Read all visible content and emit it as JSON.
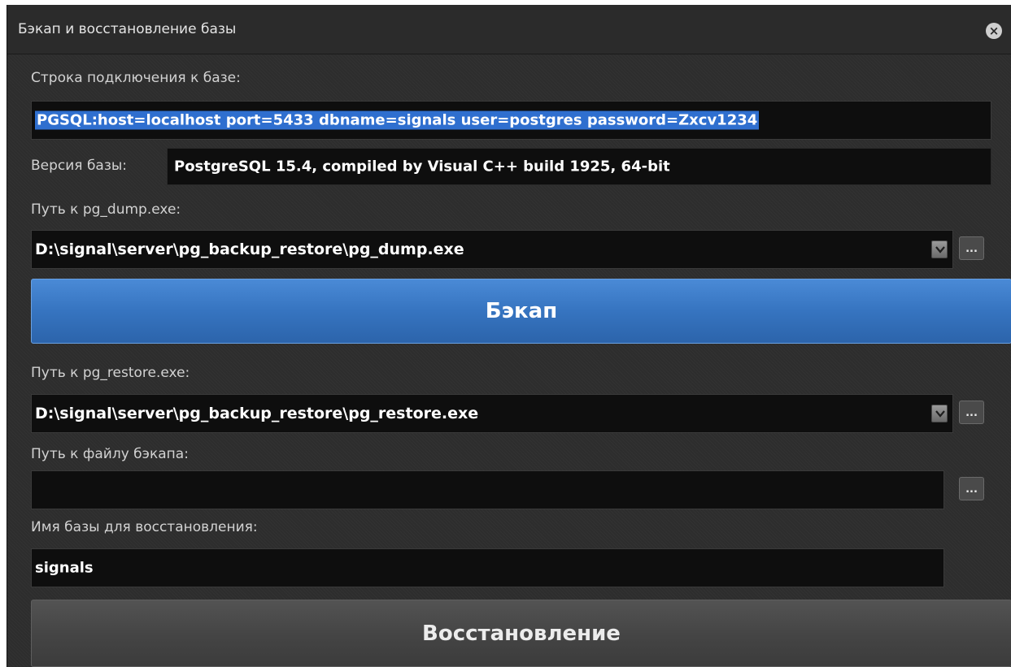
{
  "window": {
    "title": "Бэкап и восстановление базы",
    "close_glyph": "×"
  },
  "connection": {
    "label": "Строка подключения к базе:",
    "value": "PGSQL:host=localhost port=5433 dbname=signals user=postgres password=Zxcv1234"
  },
  "version": {
    "label": "Версия базы:",
    "value": "PostgreSQL 15.4, compiled by Visual C++ build 1925, 64-bit"
  },
  "pg_dump": {
    "label": "Путь к pg_dump.exe:",
    "value": "D:\\signal\\server\\pg_backup_restore\\pg_dump.exe",
    "browse_label": "..."
  },
  "backup_button": {
    "label": "Бэкап"
  },
  "pg_restore": {
    "label": "Путь к pg_restore.exe:",
    "value": "D:\\signal\\server\\pg_backup_restore\\pg_restore.exe",
    "browse_label": "..."
  },
  "backup_file": {
    "label": "Путь к файлу бэкапа:",
    "value": "",
    "browse_label": "..."
  },
  "restore_db": {
    "label": "Имя базы для восстановления:",
    "value": "signals"
  },
  "restore_button": {
    "label": "Восстановление"
  },
  "colors": {
    "accent": "#3674c0",
    "selection": "#2f6fcf",
    "background": "#2d2d2d"
  },
  "icons": {
    "close": "close-icon",
    "dropdown": "chevron-down-icon"
  }
}
